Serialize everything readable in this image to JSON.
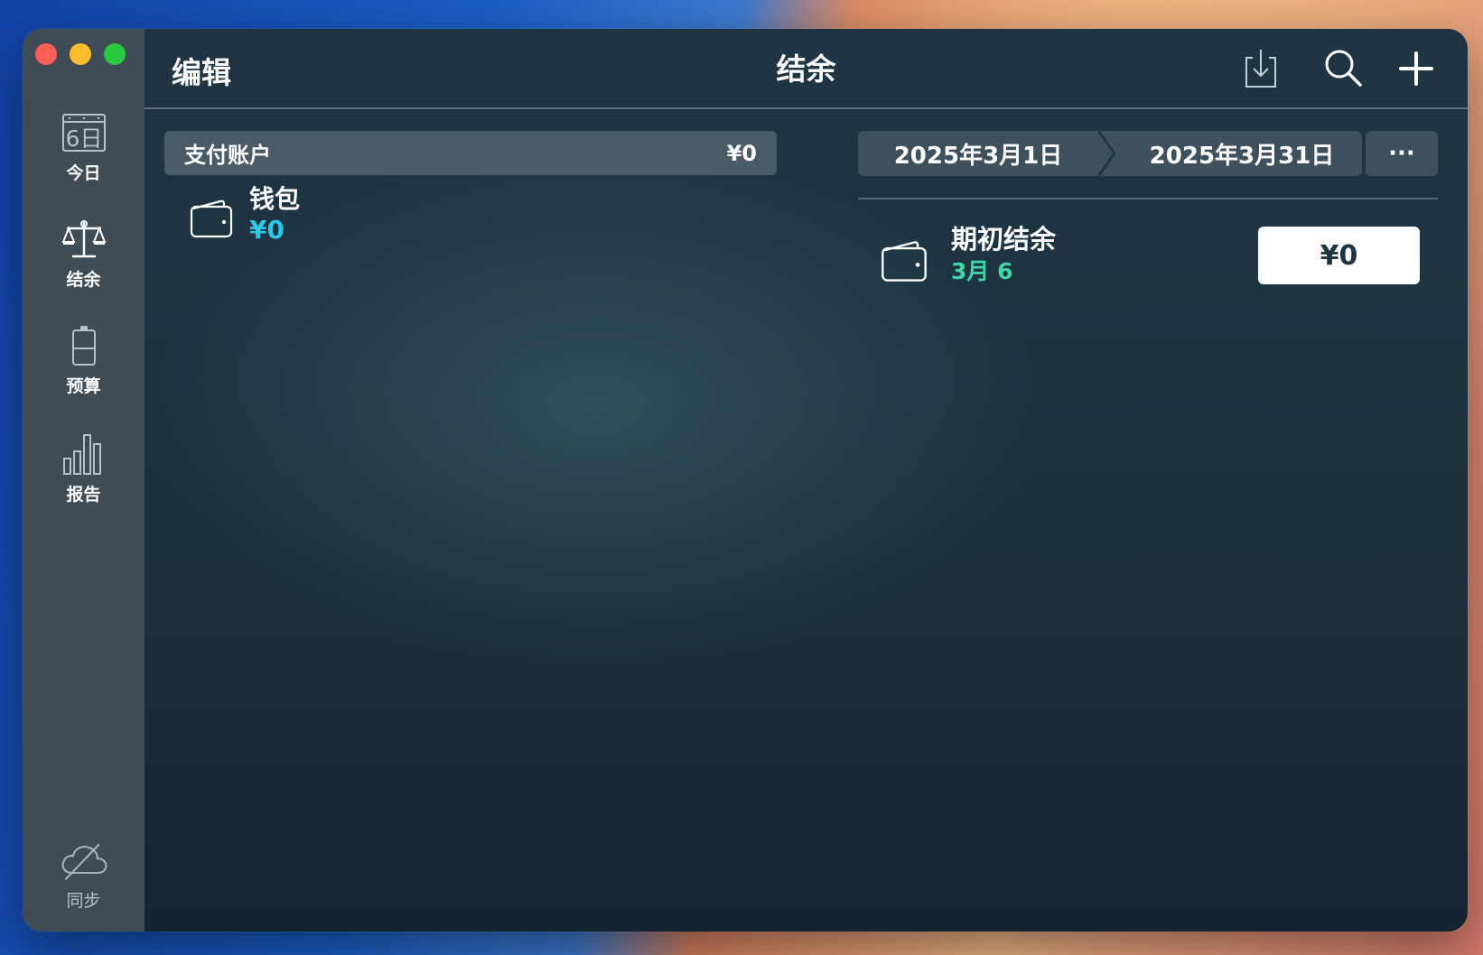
{
  "window": {
    "title": "结余"
  },
  "toolbar": {
    "edit_label": "编辑",
    "title": "结余",
    "icons": [
      "download-icon",
      "search-icon",
      "plus-icon"
    ]
  },
  "sidebar": {
    "items": [
      {
        "id": "today",
        "label": "今日",
        "icon": "calendar-icon",
        "icon_text": "6日"
      },
      {
        "id": "balance",
        "label": "结余",
        "icon": "scales-icon"
      },
      {
        "id": "budget",
        "label": "预算",
        "icon": "battery-icon"
      },
      {
        "id": "reports",
        "label": "报告",
        "icon": "bar-chart-icon"
      }
    ],
    "sync": {
      "label": "同步",
      "icon": "cloud-off-icon"
    }
  },
  "accounts": {
    "group_label": "支付账户",
    "group_total": "¥0",
    "items": [
      {
        "name": "钱包",
        "amount": "¥0",
        "icon": "wallet-icon"
      }
    ]
  },
  "date_range": {
    "start": "2025年3月1日",
    "end": "2025年3月31日",
    "more_label": "···"
  },
  "opening_balance": {
    "title": "期初结余",
    "date": "3月 6",
    "value": "¥0",
    "icon": "wallet-icon"
  },
  "colors": {
    "accent_cyan": "#2ec6e6",
    "accent_green": "#3fd6a8",
    "sidebar_bg": "#3f4b55",
    "main_bg": "#1c2f3b"
  }
}
